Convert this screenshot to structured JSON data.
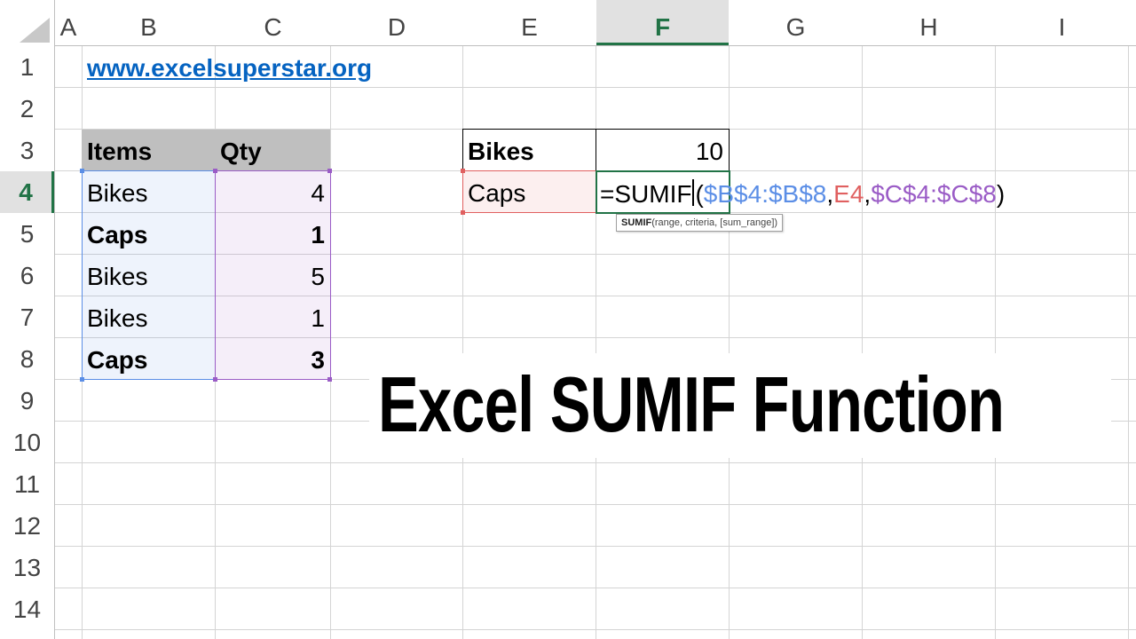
{
  "columns": [
    "A",
    "B",
    "C",
    "D",
    "E",
    "F",
    "G",
    "H",
    "I"
  ],
  "selected_column": "F",
  "rows": [
    "1",
    "2",
    "3",
    "4",
    "5",
    "6",
    "7",
    "8",
    "9",
    "10",
    "11",
    "12",
    "13",
    "14"
  ],
  "selected_row": "4",
  "link": "www.excelsuperstar.org",
  "table": {
    "headers": [
      "Items",
      "Qty"
    ],
    "rows": [
      {
        "item": "Bikes",
        "qty": "4"
      },
      {
        "item": "Caps",
        "qty": "1"
      },
      {
        "item": "Bikes",
        "qty": "5"
      },
      {
        "item": "Bikes",
        "qty": "1"
      },
      {
        "item": "Caps",
        "qty": "3"
      }
    ]
  },
  "summary": {
    "row1": {
      "label": "Bikes",
      "value": "10"
    },
    "row2": {
      "label": "Caps"
    }
  },
  "formula": {
    "fn": "=SUMIF",
    "open": "(",
    "arg1": "$B$4:$B$8",
    "sep1": ",",
    "arg2": "E4",
    "sep2": ",",
    "arg3": "$C$4:$C$8",
    "close": ")"
  },
  "tooltip": {
    "fn": "SUMIF",
    "args": "(range, criteria, [sum_range])"
  },
  "banner_title": "Excel SUMIF Function",
  "colors": {
    "accent_green": "#217346",
    "range_blue": "#5b8ee6",
    "range_purple": "#9a5cc6",
    "range_red": "#e06060",
    "link_blue": "#0563c1",
    "header_gray": "#bfbfbf"
  }
}
